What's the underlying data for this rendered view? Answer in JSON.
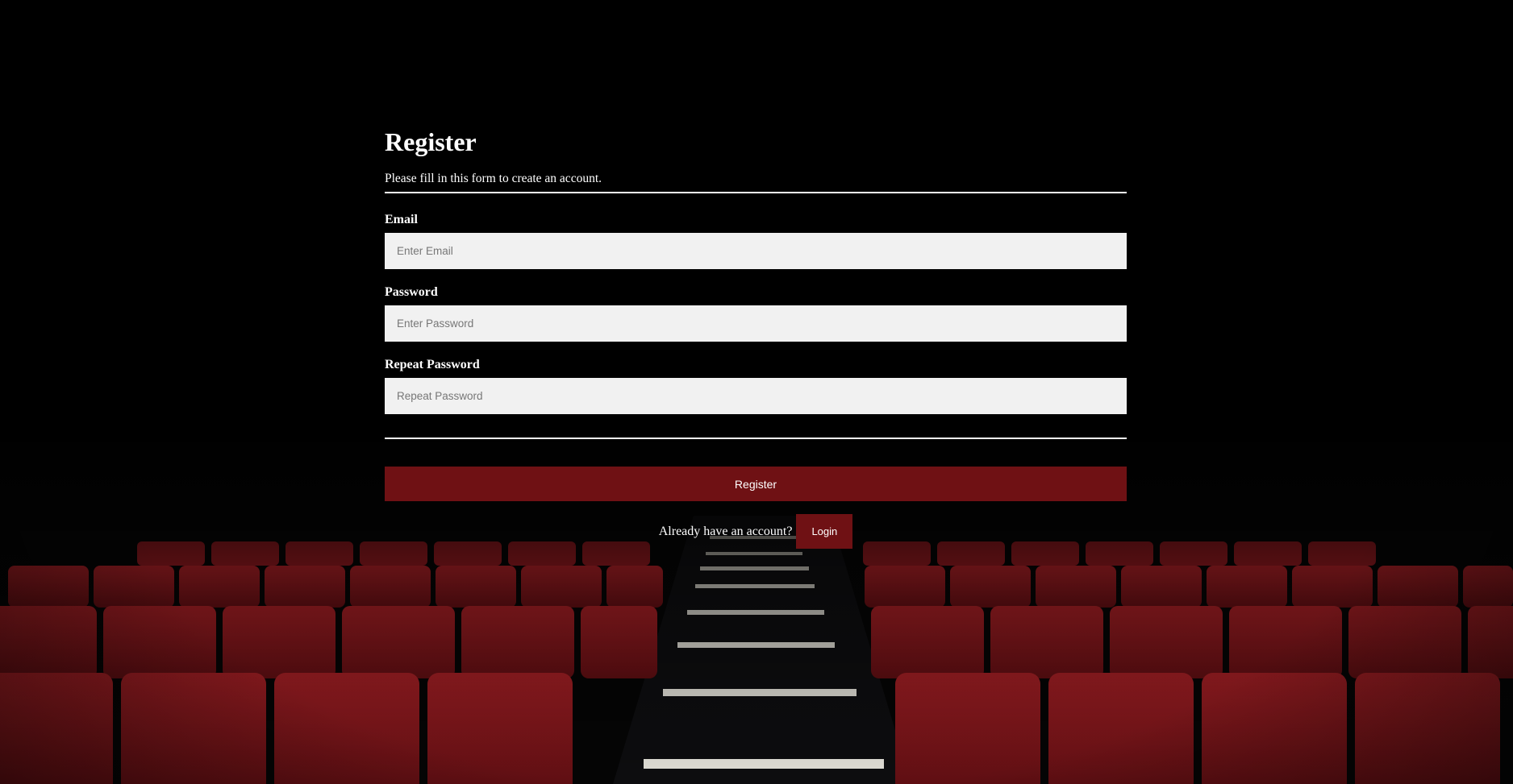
{
  "form": {
    "title": "Register",
    "subtitle": "Please fill in this form to create an account.",
    "fields": [
      {
        "label": "Email",
        "placeholder": "Enter Email",
        "value": ""
      },
      {
        "label": "Password",
        "placeholder": "Enter Password",
        "value": ""
      },
      {
        "label": "Repeat Password",
        "placeholder": "Repeat Password",
        "value": ""
      }
    ],
    "register_label": "Register",
    "signin_prompt": "Already have an account?",
    "login_label": "Login"
  },
  "colors": {
    "background": "#000000",
    "accent": "#6f1114",
    "input_bg": "#f1f1f1",
    "seat_red": "#8c1a1f"
  },
  "background_image": "dark-cinema-seats"
}
